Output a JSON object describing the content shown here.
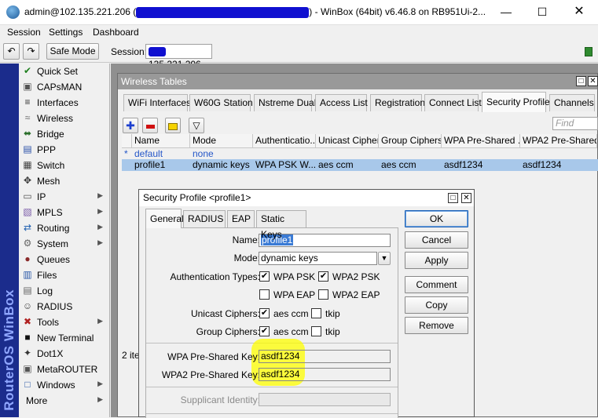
{
  "window": {
    "title_prefix": "admin@102.135.221.206 (",
    "title_suffix": ") - WinBox (64bit) v6.46.8 on RB951Ui-2..."
  },
  "menu": [
    "Session",
    "Settings",
    "Dashboard"
  ],
  "toolbar": {
    "safe_mode": "Safe Mode",
    "session_label": "Session:",
    "session_value": "135.221.206"
  },
  "brand_vertical": "RouterOS WinBox",
  "sidebar": {
    "items": [
      {
        "label": "Quick Set",
        "icon": "quick-set-icon",
        "arrow": false
      },
      {
        "label": "CAPsMAN",
        "icon": "capsman-icon",
        "arrow": false
      },
      {
        "label": "Interfaces",
        "icon": "interfaces-icon",
        "arrow": false
      },
      {
        "label": "Wireless",
        "icon": "wireless-icon",
        "arrow": false
      },
      {
        "label": "Bridge",
        "icon": "bridge-icon",
        "arrow": false
      },
      {
        "label": "PPP",
        "icon": "ppp-icon",
        "arrow": false
      },
      {
        "label": "Switch",
        "icon": "switch-icon",
        "arrow": false
      },
      {
        "label": "Mesh",
        "icon": "mesh-icon",
        "arrow": false
      },
      {
        "label": "IP",
        "icon": "ip-icon",
        "arrow": true
      },
      {
        "label": "MPLS",
        "icon": "mpls-icon",
        "arrow": true
      },
      {
        "label": "Routing",
        "icon": "routing-icon",
        "arrow": true
      },
      {
        "label": "System",
        "icon": "system-icon",
        "arrow": true
      },
      {
        "label": "Queues",
        "icon": "queues-icon",
        "arrow": false
      },
      {
        "label": "Files",
        "icon": "files-icon",
        "arrow": false
      },
      {
        "label": "Log",
        "icon": "log-icon",
        "arrow": false
      },
      {
        "label": "RADIUS",
        "icon": "radius-icon",
        "arrow": false
      },
      {
        "label": "Tools",
        "icon": "tools-icon",
        "arrow": true
      },
      {
        "label": "New Terminal",
        "icon": "terminal-icon",
        "arrow": false
      },
      {
        "label": "Dot1X",
        "icon": "dot1x-icon",
        "arrow": false
      },
      {
        "label": "MetaROUTER",
        "icon": "metarouter-icon",
        "arrow": false
      },
      {
        "label": "Windows",
        "icon": "windows-icon",
        "arrow": true
      },
      {
        "label": "More",
        "icon": "",
        "arrow": true
      }
    ]
  },
  "wireless_tables": {
    "title": "Wireless Tables",
    "tabs": [
      "WiFi Interfaces",
      "W60G Station",
      "Nstreme Dual",
      "Access List",
      "Registration",
      "Connect List",
      "Security Profiles",
      "Channels"
    ],
    "active_tab": "Security Profiles",
    "find_placeholder": "Find",
    "columns": [
      "Name",
      "Mode",
      "Authenticatio...",
      "Unicast Ciphers",
      "Group Ciphers",
      "WPA Pre-Shared ...",
      "WPA2 Pre-Shared"
    ],
    "rows": [
      {
        "marker": "*",
        "name": "default",
        "mode": "none",
        "auth": "",
        "unicast": "",
        "group": "",
        "wpa": "",
        "wpa2": ""
      },
      {
        "marker": "",
        "name": "profile1",
        "mode": "dynamic keys",
        "auth": "WPA PSK W...",
        "unicast": "aes ccm",
        "group": "aes ccm",
        "wpa": "asdf1234",
        "wpa2": "asdf1234"
      }
    ],
    "status": "2 ite"
  },
  "dialog": {
    "title": "Security Profile <profile1>",
    "tabs": [
      "General",
      "RADIUS",
      "EAP",
      "Static Keys"
    ],
    "active_tab": "General",
    "fields": {
      "name_label": "Name:",
      "name_value": "profile1",
      "mode_label": "Mode:",
      "mode_value": "dynamic keys",
      "auth_label": "Authentication Types:",
      "auth_wpa_psk": "WPA PSK",
      "auth_wpa2_psk": "WPA2 PSK",
      "auth_wpa_eap": "WPA EAP",
      "auth_wpa2_eap": "WPA2 EAP",
      "unicast_label": "Unicast Ciphers:",
      "group_label": "Group Ciphers:",
      "aes_ccm": "aes ccm",
      "tkip": "tkip",
      "wpa_key_label": "WPA Pre-Shared Key:",
      "wpa_key_value": "asdf1234",
      "wpa2_key_label": "WPA2 Pre-Shared Key:",
      "wpa2_key_value": "asdf1234",
      "supplicant_label": "Supplicant Identity:"
    },
    "checks": {
      "wpa_psk": true,
      "wpa2_psk": true,
      "wpa_eap": false,
      "wpa2_eap": false,
      "unicast_aes": true,
      "unicast_tkip": false,
      "group_aes": true,
      "group_tkip": false
    },
    "buttons": [
      "OK",
      "Cancel",
      "Apply",
      "Comment",
      "Copy",
      "Remove"
    ]
  },
  "colors": {
    "brand_strip": "#1b2c8c",
    "selection": "#a8c8ea",
    "highlight": "#ffff00",
    "redaction": "#1010d0"
  }
}
